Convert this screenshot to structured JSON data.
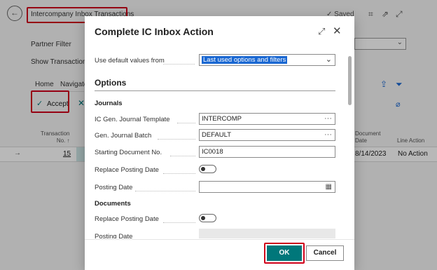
{
  "background": {
    "page_title": "Intercompany Inbox Transactions",
    "saved_label": "Saved",
    "partner_filter_label": "Partner Filter",
    "show_transaction_label": "Show Transaction S",
    "nav_home": "Home",
    "nav_navigate": "Navigate",
    "accept_label": "Accept",
    "col_transaction_no": "Transaction No. ↑",
    "col_document_date": "Document Date",
    "col_line_action": "Line Action",
    "row": {
      "transaction_no": "15",
      "document_date": "8/14/2023",
      "line_action": "No Action"
    }
  },
  "dialog": {
    "title": "Complete IC Inbox Action",
    "default_values_label": "Use default values from",
    "default_values_value": "Last used options and filters",
    "options_heading": "Options",
    "journals_heading": "Journals",
    "ic_template_label": "IC Gen. Journal Template",
    "ic_template_value": "INTERCOMP",
    "gen_batch_label": "Gen. Journal Batch",
    "gen_batch_value": "DEFAULT",
    "starting_doc_label": "Starting Document No.",
    "starting_doc_value": "IC0018",
    "replace_posting_label": "Replace Posting Date",
    "posting_date_label": "Posting Date",
    "documents_heading": "Documents",
    "replace_posting_label_2": "Replace Posting Date",
    "posting_date_label_2": "Posting Date",
    "ok_label": "OK",
    "cancel_label": "Cancel"
  },
  "colors": {
    "accent": "#00777a",
    "highlight_red": "#d0021b",
    "selection_blue": "#1967d2"
  }
}
